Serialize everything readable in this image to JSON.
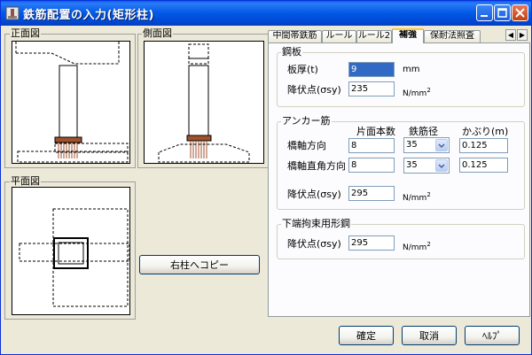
{
  "window": {
    "title": "鉄筋配置の入力(矩形柱)"
  },
  "left": {
    "front_view_label": "正面図",
    "side_view_label": "側面図",
    "plan_view_label": "平面図",
    "copy_button": "右柱へコピー"
  },
  "tabs": [
    {
      "label": "中間帯鉄筋",
      "active": false
    },
    {
      "label": "ルール",
      "active": false
    },
    {
      "label": "ルール2",
      "active": false
    },
    {
      "label": "補強",
      "active": true
    },
    {
      "label": "保耐法照査",
      "active": false
    }
  ],
  "tab_scroll": {
    "left": "◀",
    "right": "▶"
  },
  "steel_plate": {
    "group_label": "鋼板",
    "thickness_label": "板厚(t)",
    "thickness_value": "9",
    "thickness_unit": "mm",
    "yield_label": "降伏点(σsy)",
    "yield_value": "235",
    "yield_unit": "N/mm",
    "yield_unit_exp": "2"
  },
  "anchor": {
    "group_label": "アンカー筋",
    "col_count": "片面本数",
    "col_diameter": "鉄筋径",
    "col_cover": "かぶり(m)",
    "row1_label": "橋軸方向",
    "row1_count": "8",
    "row1_diameter": "35",
    "row1_cover": "0.125",
    "row2_label": "橋軸直角方向",
    "row2_count": "8",
    "row2_diameter": "35",
    "row2_cover": "0.125",
    "yield_label": "降伏点(σsy)",
    "yield_value": "295",
    "yield_unit": "N/mm",
    "yield_unit_exp": "2"
  },
  "bottom_steel": {
    "group_label": "下端拘束用形鋼",
    "yield_label": "降伏点(σsy)",
    "yield_value": "295",
    "yield_unit": "N/mm",
    "yield_unit_exp": "2"
  },
  "footer": {
    "ok": "確定",
    "cancel": "取消",
    "help": "ﾍﾙﾌﾟ"
  },
  "colors": {
    "title_bar": "#0058e6",
    "selection": "#316ac5",
    "rebar": "#a0522d"
  }
}
